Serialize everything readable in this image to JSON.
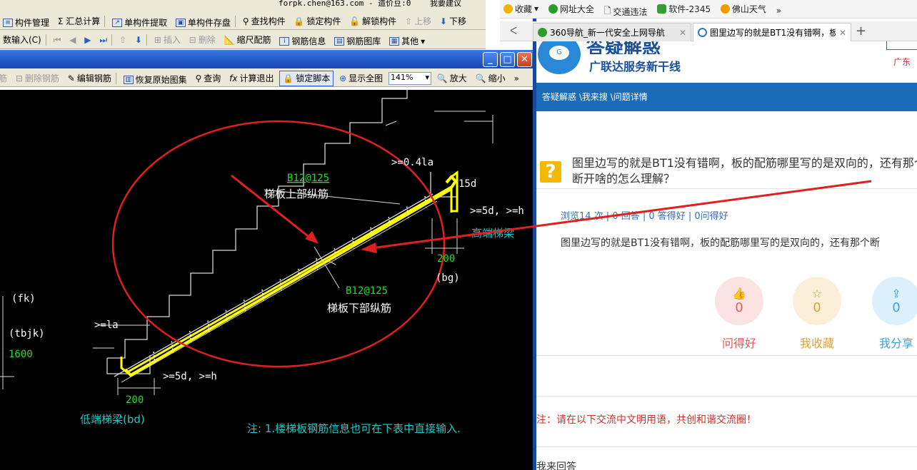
{
  "app": {
    "topline": {
      "email": "forpk.chen@163.com",
      "credit": "- 造价豆:0",
      "suggest": "我要建议"
    },
    "toolbar1": [
      {
        "name": "component-manage",
        "label": "构件管理"
      },
      {
        "name": "summary-calc",
        "label": "Σ 汇总计算"
      },
      {
        "name": "single-extract",
        "label": "单构件提取"
      },
      {
        "name": "single-save",
        "label": "单构件存盘"
      },
      {
        "name": "find-component",
        "label": "查找构件"
      },
      {
        "name": "lock-component",
        "label": "锁定构件"
      },
      {
        "name": "unlock-component",
        "label": "解锁构件"
      },
      {
        "name": "move-up",
        "label": "上移"
      },
      {
        "name": "move-down",
        "label": "下移"
      }
    ],
    "toolbar2": [
      {
        "name": "param-input",
        "label": "数输入(C)"
      },
      {
        "name": "insert",
        "label": "插入"
      },
      {
        "name": "delete",
        "label": "删除"
      },
      {
        "name": "scale-rebar",
        "label": "缩尺配筋"
      },
      {
        "name": "rebar-info",
        "label": "钢筋信息"
      },
      {
        "name": "rebar-library",
        "label": "钢筋图库"
      },
      {
        "name": "others",
        "label": "其他"
      }
    ],
    "toolbar3": [
      {
        "name": "add-rebar",
        "label": "筋"
      },
      {
        "name": "delete-rebar",
        "label": "删除钢筋"
      },
      {
        "name": "edit-rebar",
        "label": "编辑钢筋"
      },
      {
        "name": "restore-atlas",
        "label": "恢复原始图集"
      },
      {
        "name": "query",
        "label": "查询"
      },
      {
        "name": "calc-exit",
        "label": "计算退出"
      },
      {
        "name": "lock-script",
        "label": "锁定脚本"
      },
      {
        "name": "show-all",
        "label": "显示全图"
      },
      {
        "name": "zoom-in",
        "label": "放大"
      },
      {
        "name": "zoom-out",
        "label": "缩小"
      }
    ],
    "zoom_value": "141%",
    "cad": {
      "top_dim": ">=0.4la",
      "top_rebar_spec": "B12@125",
      "top_rebar_label": "梯板上部纵筋",
      "dim_15d": "15d",
      "dim_top_anchor": ">=5d, >=h",
      "high_beam": "高端梯梁",
      "dim_200_right": "200",
      "bg": "(bg)",
      "bottom_rebar_spec": "B12@125",
      "bottom_rebar_label": "梯板下部纵筋",
      "fk": "(fk)",
      "tbjk": "(tbjk)",
      "width_1600": "1600",
      "dim_la": ">=la",
      "dim_bottom_anchor": ">=5d, >=h",
      "dim_200_left": "200",
      "low_beam": "低端梯梁(bd)",
      "note": "注: 1.楼梯板钢筋信息也可在下表中直接输入."
    }
  },
  "browser": {
    "favbar": [
      {
        "name": "favorites",
        "label": "收藏",
        "color": "#f2b400"
      },
      {
        "name": "site-nav",
        "label": "网址大全",
        "color": "#2e9b2e"
      },
      {
        "name": "traffic",
        "label": "交通违法",
        "color": "#888888"
      },
      {
        "name": "software",
        "label": "软件-2345",
        "color": "#3a9a3a"
      },
      {
        "name": "weather",
        "label": "佛山天气",
        "color": "#f29b00"
      }
    ],
    "tabs": [
      {
        "name": "tab-360",
        "label": "360导航_新一代安全上网导航",
        "active": false
      },
      {
        "name": "tab-question",
        "label": "图里边写的就是BT1没有错啊，板",
        "active": true
      }
    ],
    "site": {
      "slogan": "广联达服务新干线",
      "logo_text": "答疑解惑",
      "region": "广东",
      "breadcrumb": "答疑解惑 \\我来搜 \\问题详情",
      "question": "图里边写的就是BT1没有错啊，板的配筋哪里写的是双向的，还有那个断开啥的怎么理解？",
      "stats": "浏览14 次 | 0 回答 | 0 答得好 | 0问得好",
      "body": "图里边写的就是BT1没有错啊，板的配筋哪里写的是双向的，还有那个断",
      "actions": [
        {
          "name": "ask-good",
          "count": "0",
          "label": "问得好",
          "color": "#e05a5a",
          "bg": "#fbe3e3"
        },
        {
          "name": "my-collect",
          "count": "0",
          "label": "我收藏",
          "color": "#e0a030",
          "bg": "#fcefd9"
        },
        {
          "name": "my-share",
          "count": "0",
          "label": "我分享",
          "color": "#3aa0e0",
          "bg": "#dcf0fb"
        }
      ],
      "notice": "注：请在以下交流中文明用语，共创和谐交流圈！",
      "answer_heading": "我来回答"
    }
  }
}
